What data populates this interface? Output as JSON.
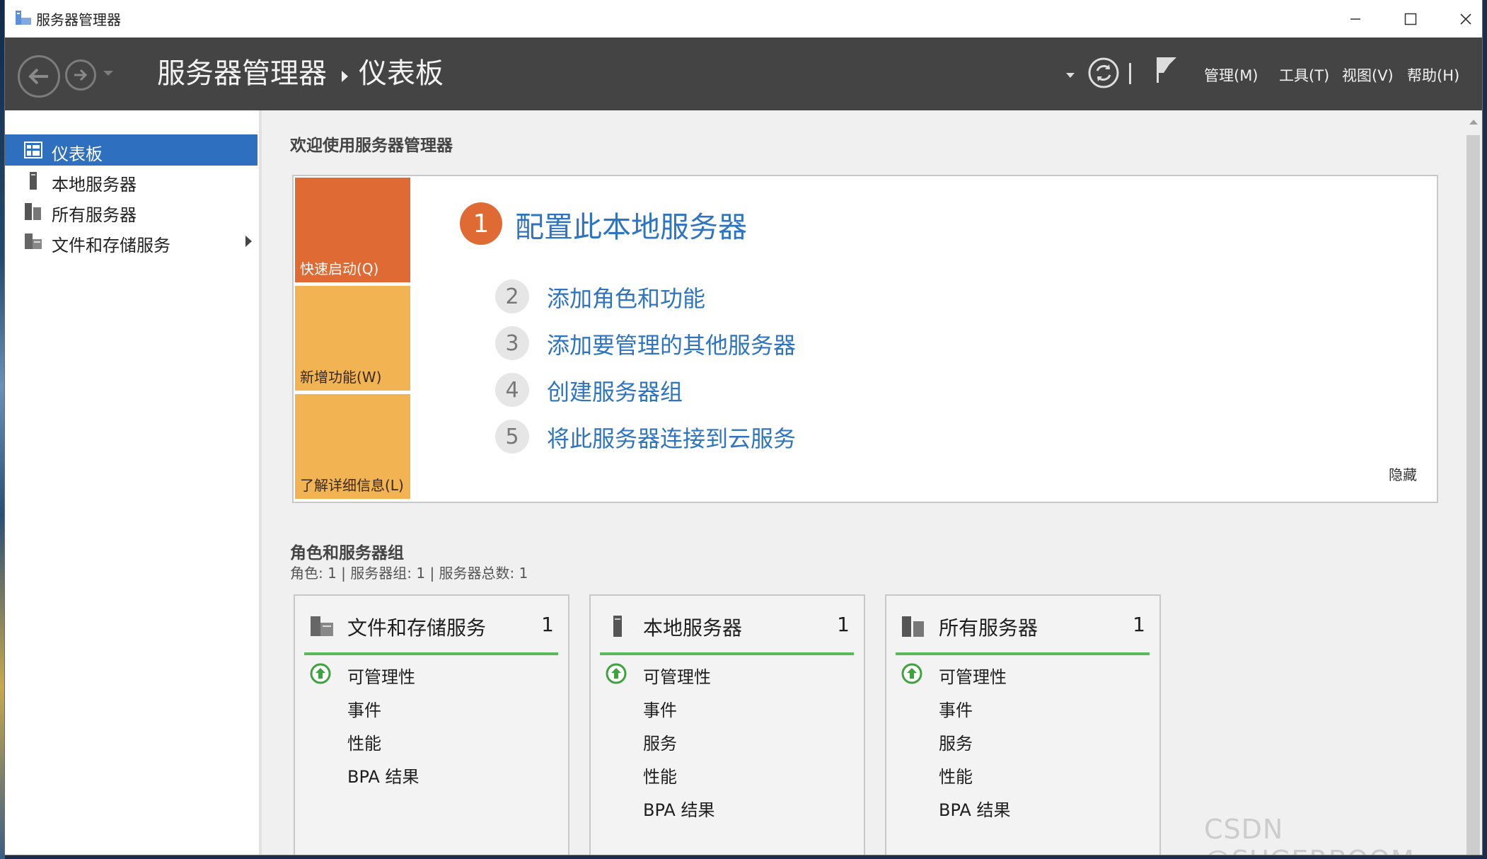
{
  "window": {
    "title": "服务器管理器"
  },
  "header": {
    "breadcrumb_root": "服务器管理器",
    "breadcrumb_current": "仪表板",
    "menus": [
      "管理(M)",
      "工具(T)",
      "视图(V)",
      "帮助(H)"
    ]
  },
  "sidebar": {
    "items": [
      {
        "label": "仪表板",
        "icon": "dashboard-icon",
        "selected": true
      },
      {
        "label": "本地服务器",
        "icon": "server-icon"
      },
      {
        "label": "所有服务器",
        "icon": "servers-icon"
      },
      {
        "label": "文件和存储服务",
        "icon": "storage-icon",
        "has_submenu": true
      }
    ]
  },
  "welcome": {
    "heading": "欢迎使用服务器管理器",
    "tiles": [
      {
        "label": "快速启动(Q)",
        "color": "#e06a34"
      },
      {
        "label": "新增功能(W)",
        "color": "#f2b352"
      },
      {
        "label": "了解详细信息(L)",
        "color": "#f2b352"
      }
    ],
    "steps": [
      {
        "num": "1",
        "label": "配置此本地服务器"
      },
      {
        "num": "2",
        "label": "添加角色和功能"
      },
      {
        "num": "3",
        "label": "添加要管理的其他服务器"
      },
      {
        "num": "4",
        "label": "创建服务器组"
      },
      {
        "num": "5",
        "label": "将此服务器连接到云服务"
      }
    ],
    "hide_label": "隐藏"
  },
  "roles": {
    "heading": "角色和服务器组",
    "summary": "角色: 1 | 服务器组: 1 | 服务器总数: 1",
    "cards": [
      {
        "title": "文件和存储服务",
        "count": "1",
        "icon": "storage-icon",
        "rows": [
          "可管理性",
          "事件",
          "性能",
          "BPA 结果"
        ]
      },
      {
        "title": "本地服务器",
        "count": "1",
        "icon": "server-icon",
        "rows": [
          "可管理性",
          "事件",
          "服务",
          "性能",
          "BPA 结果"
        ]
      },
      {
        "title": "所有服务器",
        "count": "1",
        "icon": "servers-icon",
        "rows": [
          "可管理性",
          "事件",
          "服务",
          "性能",
          "BPA 结果"
        ]
      }
    ]
  },
  "watermark": "CSDN @SUGERBOOM",
  "colors": {
    "accent": "#2f6fbf",
    "link": "#2e74c0",
    "header_bg": "#444444",
    "status_ok": "#5cb85c"
  }
}
